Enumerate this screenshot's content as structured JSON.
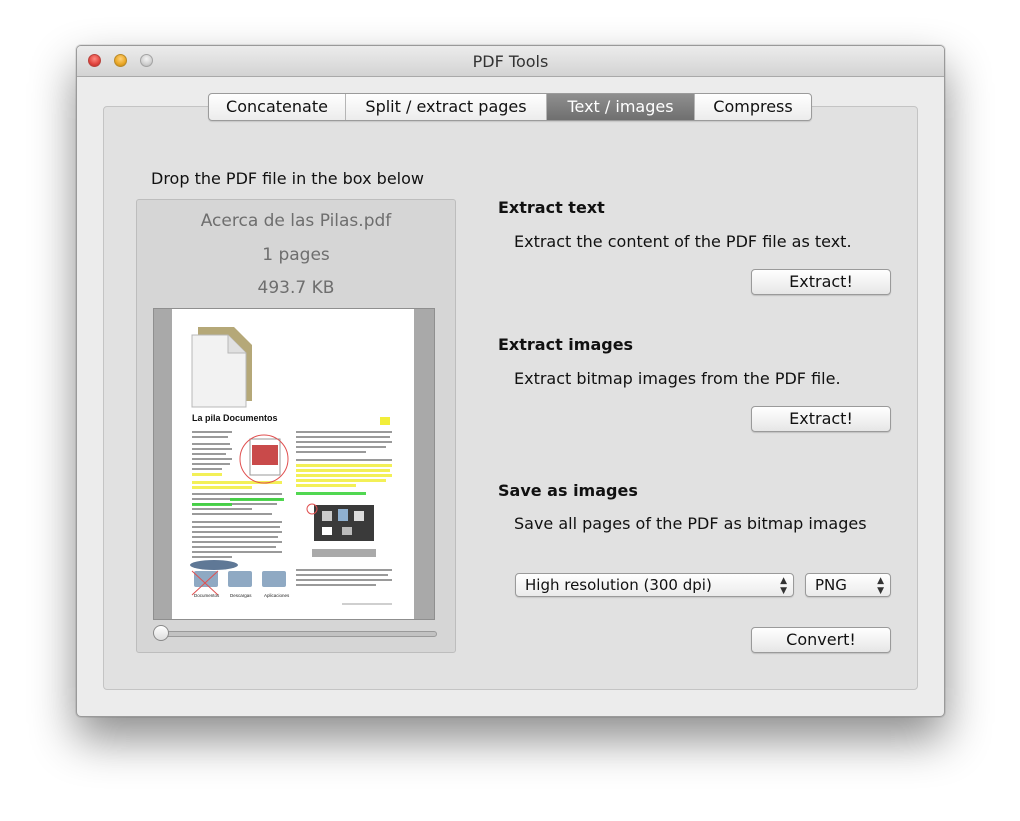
{
  "window": {
    "title": "PDF Tools"
  },
  "tabs": [
    {
      "label": "Concatenate",
      "active": false
    },
    {
      "label": "Split / extract pages",
      "active": false
    },
    {
      "label": "Text / images",
      "active": true
    },
    {
      "label": "Compress",
      "active": false
    }
  ],
  "drop": {
    "label": "Drop the PDF file in the box below",
    "file_name": "Acerca de las Pilas.pdf",
    "pages": "1 pages",
    "size": "493.7 KB",
    "zoom_level": 0
  },
  "preview": {
    "heading": "La pila Documentos",
    "icon_labels": [
      "Documentos",
      "Descargas",
      "Aplicaciones"
    ]
  },
  "extract_text": {
    "title": "Extract text",
    "description": "Extract the content of the PDF file as text.",
    "button": "Extract!"
  },
  "extract_images": {
    "title": "Extract images",
    "description": "Extract bitmap images from the PDF file.",
    "button": "Extract!"
  },
  "save_images": {
    "title": "Save as images",
    "description": "Save all pages of the PDF as bitmap images",
    "resolution": "High resolution (300 dpi)",
    "format": "PNG",
    "button": "Convert!"
  },
  "colors": {
    "window_bg": "#ececec",
    "active_tab": "#7d7d7d",
    "highlight_yellow": "#f2ee3a",
    "highlight_green": "#3fd33f",
    "close": "#e0443e",
    "minimize": "#e9a625",
    "zoom": "#c9c9c9"
  }
}
